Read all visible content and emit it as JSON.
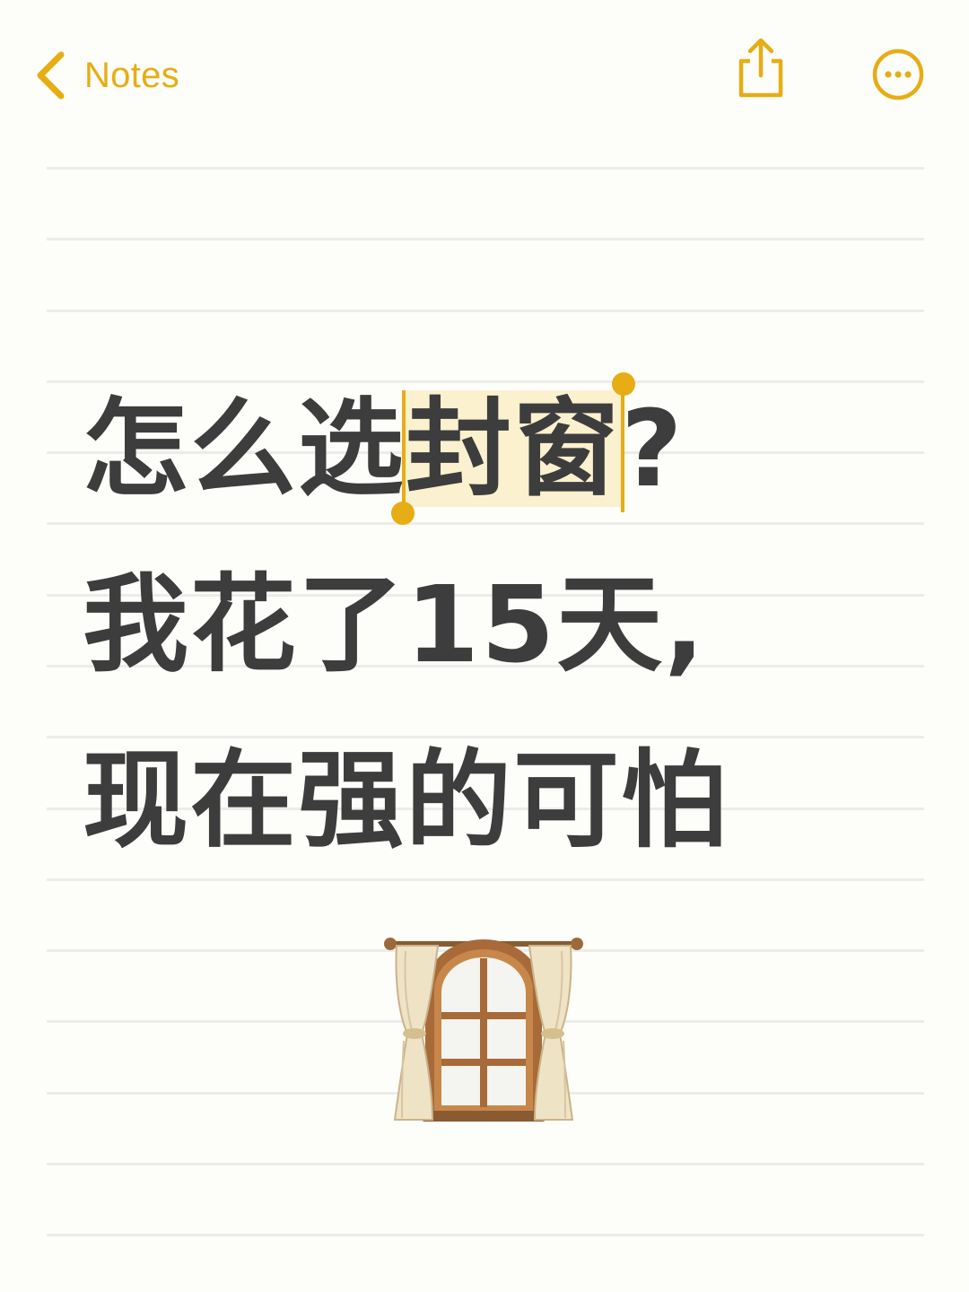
{
  "nav": {
    "back_label": "Notes",
    "back_icon": "chevron-left-icon",
    "share_icon": "share-icon",
    "more_icon": "more-ellipsis-icon",
    "accent_color": "#e6ad14"
  },
  "note": {
    "line1_before": "怎么选",
    "line1_selected": "封窗",
    "line1_after": "?",
    "line2": "我花了15天,",
    "line3": "现在强的可怕",
    "emoji": "window-with-curtains"
  }
}
